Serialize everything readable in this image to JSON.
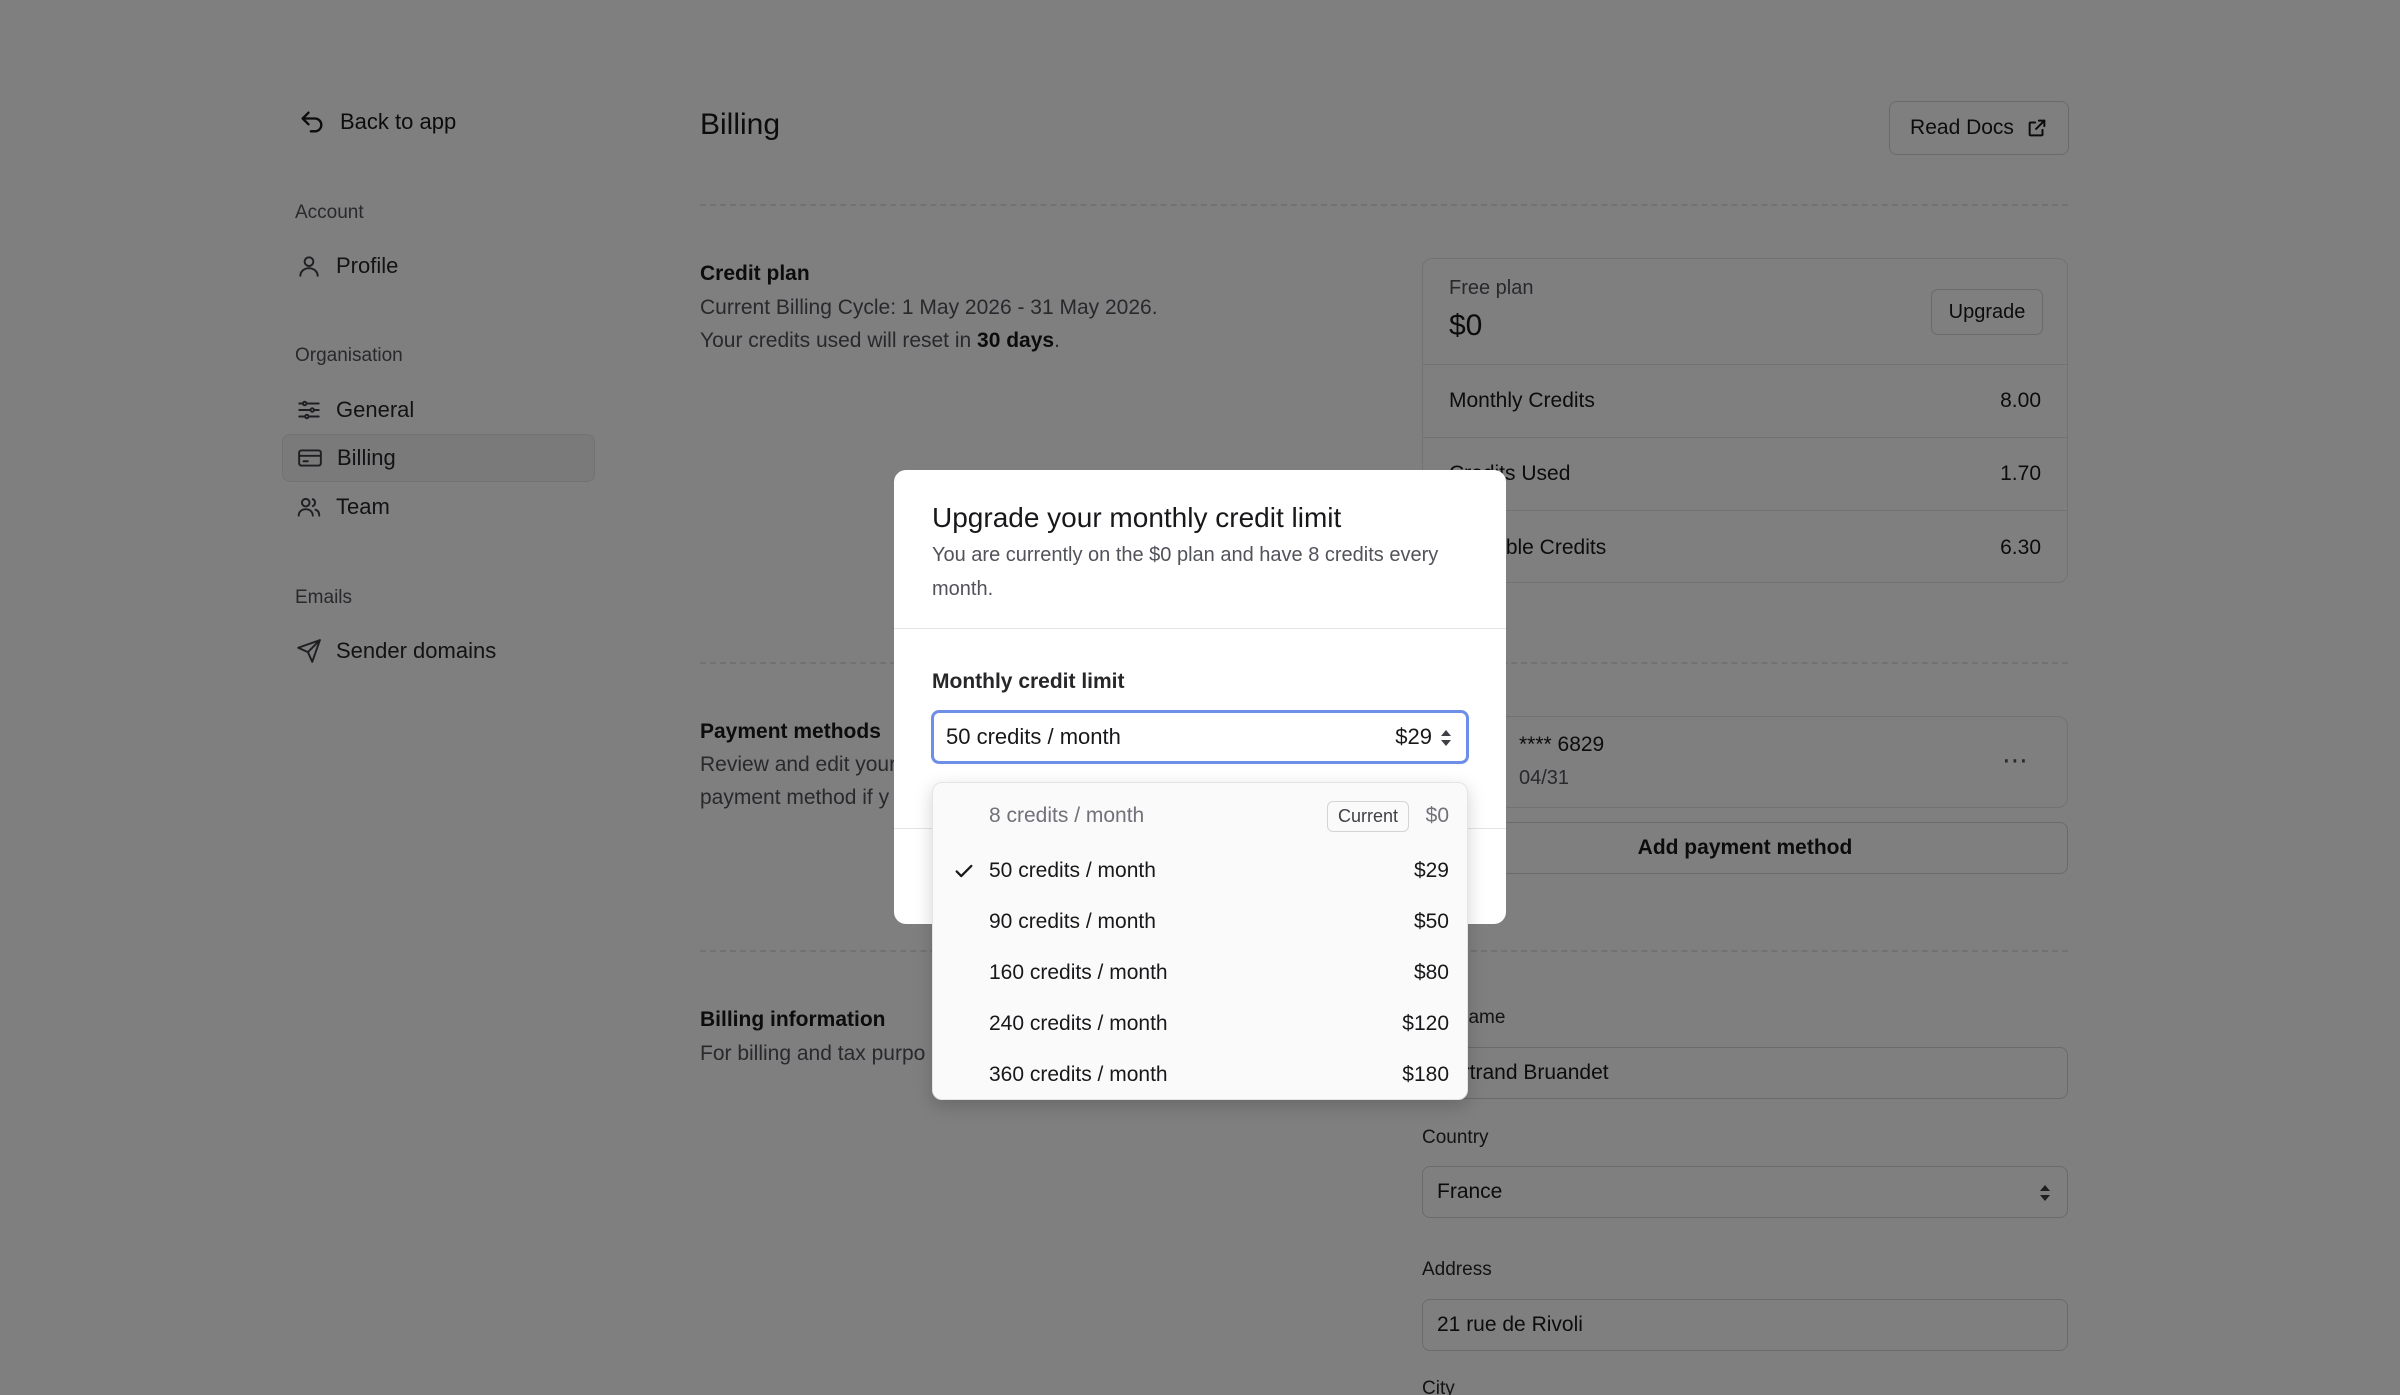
{
  "sidebar": {
    "back_label": "Back to app",
    "sections": [
      {
        "title": "Account",
        "items": [
          {
            "label": "Profile",
            "icon": "user-icon"
          }
        ]
      },
      {
        "title": "Organisation",
        "items": [
          {
            "label": "General",
            "icon": "sliders-icon"
          },
          {
            "label": "Billing",
            "icon": "credit-card-icon",
            "active": true
          },
          {
            "label": "Team",
            "icon": "users-icon"
          }
        ]
      },
      {
        "title": "Emails",
        "items": [
          {
            "label": "Sender domains",
            "icon": "send-icon"
          }
        ]
      }
    ]
  },
  "header": {
    "title": "Billing",
    "docs_label": "Read Docs"
  },
  "credit_plan": {
    "title": "Credit plan",
    "cycle_line": "Current Billing Cycle: 1 May 2026 - 31 May 2026.",
    "reset_prefix": "Your credits used will reset in ",
    "reset_days": "30 days",
    "reset_suffix": "."
  },
  "plan_card": {
    "name": "Free plan",
    "price": "$0",
    "upgrade_label": "Upgrade",
    "rows": [
      {
        "label": "Monthly Credits",
        "value": "8.00"
      },
      {
        "label": "Credits Used",
        "value": "1.70"
      },
      {
        "label": "Available Credits",
        "value": "6.30"
      }
    ]
  },
  "payment_methods": {
    "title": "Payment methods",
    "desc_line1": "Review and edit your",
    "desc_line2": "payment method if y",
    "card_number": "**** 6829",
    "card_expiry": "04/31",
    "more_label": "⋯",
    "add_label": "Add payment method"
  },
  "billing_info": {
    "title": "Billing information",
    "desc": "For billing and tax purpo",
    "name_label": "Full name",
    "name_value": "Bertrand Bruandet",
    "country_label": "Country",
    "country_value": "France",
    "address_label": "Address",
    "address_value": "21 rue de Rivoli",
    "city_label": "City"
  },
  "modal": {
    "title": "Upgrade your monthly credit limit",
    "desc": "You are currently on the $0 plan and have 8 credits every month.",
    "field_label": "Monthly credit limit",
    "selected_label": "50 credits / month",
    "selected_price": "$29"
  },
  "dropdown": {
    "current_badge": "Current",
    "options": [
      {
        "label": "8 credits / month",
        "price": "$0",
        "current": true,
        "disabled": true
      },
      {
        "label": "50 credits / month",
        "price": "$29",
        "selected": true
      },
      {
        "label": "90 credits / month",
        "price": "$50"
      },
      {
        "label": "160 credits / month",
        "price": "$80"
      },
      {
        "label": "240 credits / month",
        "price": "$120"
      },
      {
        "label": "360 credits / month",
        "price": "$180"
      }
    ]
  },
  "colors": {
    "focus_ring": "#6d8fe8",
    "overlay": "rgba(0,0,0,0.5)",
    "primary": "#18181b"
  }
}
